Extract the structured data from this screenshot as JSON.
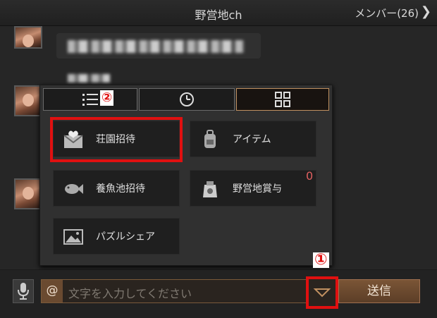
{
  "header": {
    "title": "野営地ch",
    "members": "メンバー(26)"
  },
  "panel": {
    "tabs": [
      {
        "icon": "list-icon"
      },
      {
        "icon": "clock-icon"
      },
      {
        "icon": "grid-icon"
      }
    ],
    "tab_annotation": "②",
    "items": [
      {
        "label": "荘園招待",
        "icon": "envelope-heart-icon"
      },
      {
        "label": "アイテム",
        "icon": "backpack-icon"
      },
      {
        "label": "養魚池招待",
        "icon": "fish-icon"
      },
      {
        "label": "野営地賞与",
        "icon": "reward-bag-icon",
        "badge": "0"
      },
      {
        "label": "パズルシェア",
        "icon": "image-icon"
      }
    ]
  },
  "input": {
    "at": "@",
    "placeholder": "文字を入力してください",
    "send": "送信",
    "annotation": "①"
  },
  "colors": {
    "accent": "#7a5536",
    "highlight": "#e01010"
  }
}
